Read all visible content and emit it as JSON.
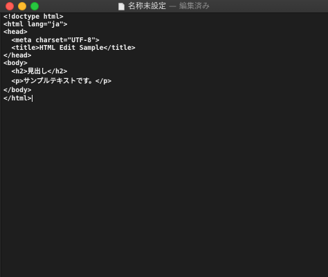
{
  "window": {
    "title": "名称未設定",
    "separator": "—",
    "status": "編集済み"
  },
  "editor": {
    "lines": [
      "<!doctype html>",
      "<html lang=\"ja\">",
      "<head>",
      "  <meta charset=\"UTF-8\">",
      "  <title>HTML Edit Sample</title>",
      "</head>",
      "<body>",
      "  <h2>見出し</h2>",
      "  <p>サンプルテキストです。</p>",
      "</body>",
      "</html>"
    ]
  },
  "icons": {
    "close": "close-icon",
    "minimize": "minimize-icon",
    "zoom": "zoom-icon",
    "document": "document-icon"
  },
  "colors": {
    "background": "#1e1e1e",
    "text": "#f2f2f2",
    "close": "#fd5f57",
    "minimize": "#febc2e",
    "zoom": "#28c840"
  }
}
